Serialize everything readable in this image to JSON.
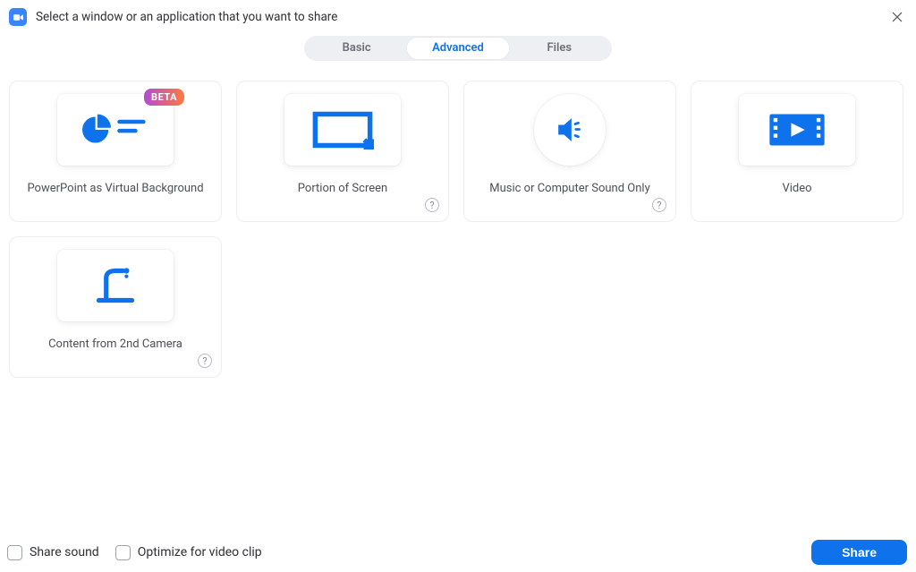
{
  "header": {
    "title": "Select a window or an application that you want to share"
  },
  "tabs": {
    "basic": "Basic",
    "advanced": "Advanced",
    "files": "Files",
    "active": "advanced"
  },
  "options": {
    "ppt_virtual_bg": {
      "label": "PowerPoint as Virtual Background",
      "badge": "BETA"
    },
    "portion_of_screen": {
      "label": "Portion of Screen"
    },
    "computer_sound": {
      "label": "Music or Computer Sound Only"
    },
    "video": {
      "label": "Video"
    },
    "second_camera": {
      "label": "Content from 2nd Camera"
    }
  },
  "footer": {
    "share_sound": "Share sound",
    "optimize_clip": "Optimize for video clip",
    "share_button": "Share"
  },
  "colors": {
    "accent": "#0e72ed"
  }
}
